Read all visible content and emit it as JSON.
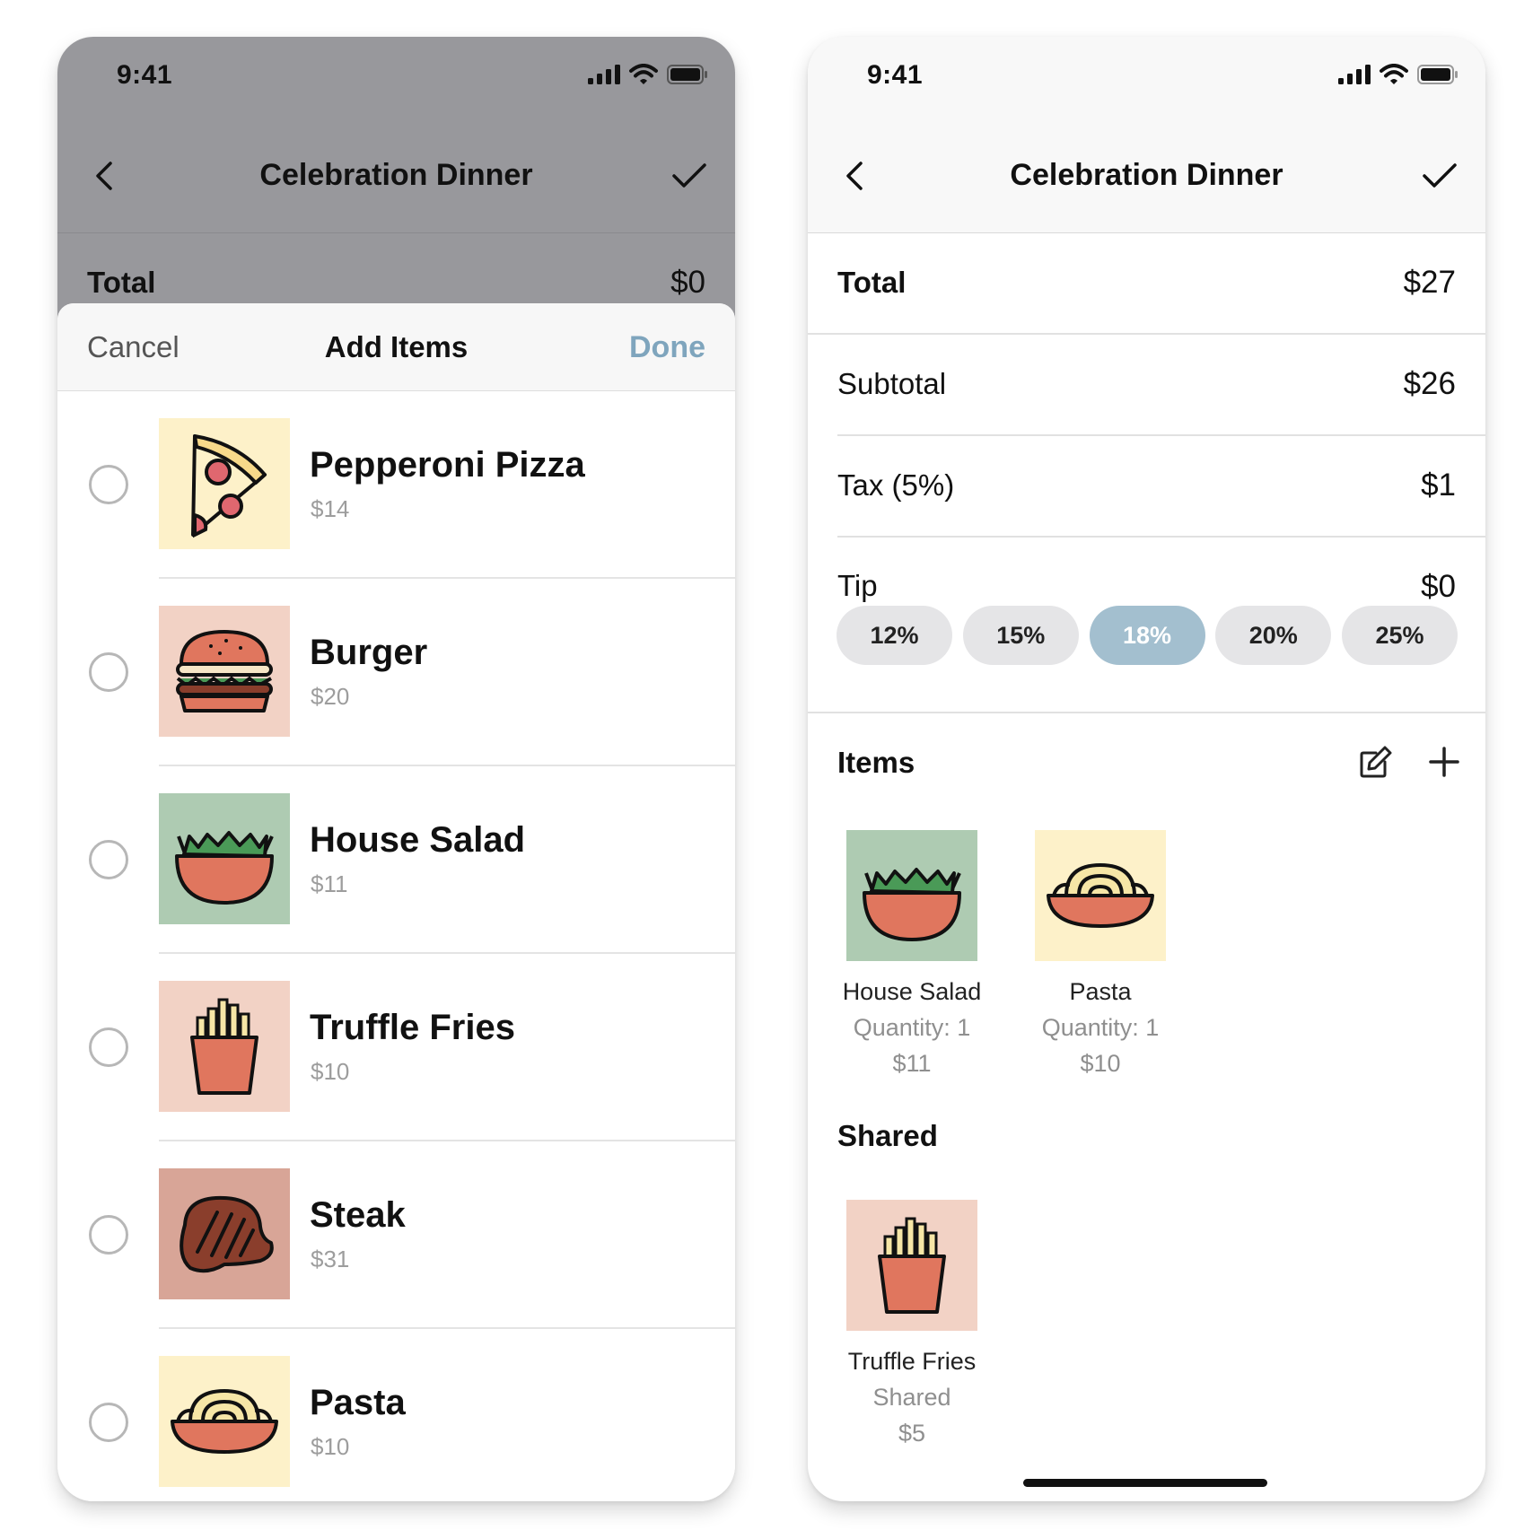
{
  "colors": {
    "dim_overlay": "#98989c",
    "accent_done": "#7fa5bd",
    "tip_active": "#a3bfcf",
    "pill_inactive": "#e5e5e7",
    "muted_text": "#9d9d9d"
  },
  "left_screen": {
    "status": {
      "time": "9:41"
    },
    "nav": {
      "back_icon": "chevron-left-icon",
      "title": "Celebration Dinner",
      "confirm_icon": "checkmark-icon"
    },
    "total": {
      "label": "Total",
      "value": "$0"
    },
    "sheet": {
      "cancel": "Cancel",
      "title": "Add Items",
      "done": "Done",
      "items": [
        {
          "name": "Pepperoni Pizza",
          "price": "$14",
          "icon": "pizza-icon",
          "bg": "#fdf1c9",
          "selected": false
        },
        {
          "name": "Burger",
          "price": "$20",
          "icon": "burger-icon",
          "bg": "#f2d2c5",
          "selected": false
        },
        {
          "name": "House Salad",
          "price": "$11",
          "icon": "salad-icon",
          "bg": "#aecbb2",
          "selected": false
        },
        {
          "name": "Truffle Fries",
          "price": "$10",
          "icon": "fries-icon",
          "bg": "#f2d2c5",
          "selected": false
        },
        {
          "name": "Steak",
          "price": "$31",
          "icon": "steak-icon",
          "bg": "#d8a597",
          "selected": false
        },
        {
          "name": "Pasta",
          "price": "$10",
          "icon": "pasta-icon",
          "bg": "#fdf1c9",
          "selected": false
        }
      ]
    }
  },
  "right_screen": {
    "status": {
      "time": "9:41"
    },
    "nav": {
      "back_icon": "chevron-left-icon",
      "title": "Celebration Dinner",
      "confirm_icon": "checkmark-icon"
    },
    "summary": {
      "total": {
        "label": "Total",
        "value": "$27"
      },
      "subtotal": {
        "label": "Subtotal",
        "value": "$26"
      },
      "tax": {
        "label": "Tax (5%)",
        "value": "$1"
      },
      "tip": {
        "label": "Tip",
        "value": "$0"
      }
    },
    "tip_options": [
      {
        "label": "12%",
        "active": false
      },
      {
        "label": "15%",
        "active": false
      },
      {
        "label": "18%",
        "active": true
      },
      {
        "label": "20%",
        "active": false
      },
      {
        "label": "25%",
        "active": false
      }
    ],
    "items_section": {
      "title": "Items",
      "edit_icon": "edit-icon",
      "add_icon": "plus-icon",
      "items": [
        {
          "name": "House Salad",
          "detail": "Quantity: 1",
          "price": "$11",
          "icon": "salad-icon",
          "bg": "#aecbb2"
        },
        {
          "name": "Pasta",
          "detail": "Quantity: 1",
          "price": "$10",
          "icon": "pasta-icon",
          "bg": "#fdf1c9"
        }
      ]
    },
    "shared_section": {
      "title": "Shared",
      "items": [
        {
          "name": "Truffle Fries",
          "detail": "Shared",
          "price": "$5",
          "icon": "fries-icon",
          "bg": "#f2d2c5"
        }
      ]
    }
  }
}
